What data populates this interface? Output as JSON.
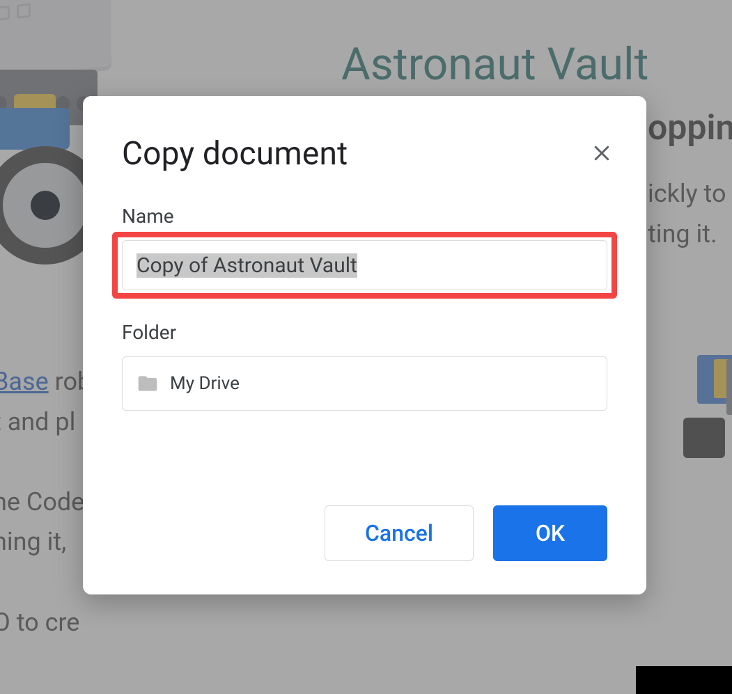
{
  "background": {
    "page_title": "Astronaut Vault",
    "subheading": "oppin",
    "body_right_line1": "ickly to",
    "body_right_line2": "ting it.",
    "left_link_text": "Base",
    "left_line1_after": " rob",
    "left_line2": "t and pl",
    "left_line3": "ne Code",
    "left_line4": "hing it,",
    "left_line5": "O to cre"
  },
  "dialog": {
    "title": "Copy document",
    "name_label": "Name",
    "name_value": "Copy of Astronaut Vault",
    "folder_label": "Folder",
    "folder_value": "My Drive",
    "cancel_label": "Cancel",
    "ok_label": "OK"
  }
}
